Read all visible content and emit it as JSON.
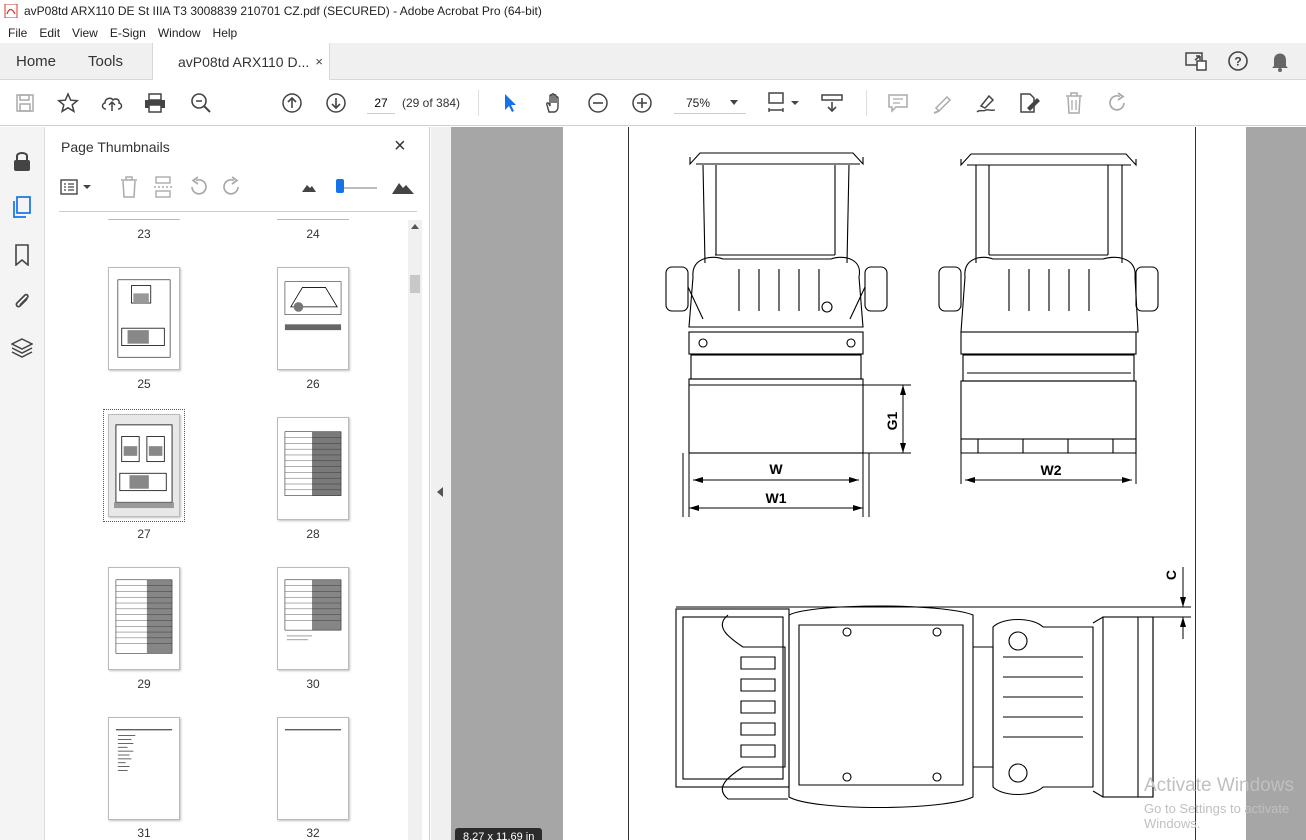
{
  "window": {
    "title": "avP08td ARX110 DE St IIIA T3 3008839 210701 CZ.pdf (SECURED) - Adobe Acrobat Pro (64-bit)"
  },
  "menu": [
    "File",
    "Edit",
    "View",
    "E-Sign",
    "Window",
    "Help"
  ],
  "tabs": {
    "home": "Home",
    "tools": "Tools",
    "document": "avP08td ARX110 D...",
    "close": "×"
  },
  "toolbar": {
    "page_number": "27",
    "page_count": "(29 of 384)",
    "zoom": "75%"
  },
  "thumbnails": {
    "title": "Page Thumbnails",
    "close": "×",
    "pages": [
      "23",
      "24",
      "25",
      "26",
      "27",
      "28",
      "29",
      "30",
      "31",
      "32"
    ],
    "selected": "27"
  },
  "document": {
    "dimension_labels": [
      "G1",
      "W",
      "W1",
      "W2",
      "C"
    ],
    "page_size": "8.27 x 11.69 in"
  },
  "watermark": {
    "line1": "Activate Windows",
    "line2": "Go to Settings to activate Windows."
  },
  "colors": {
    "accent": "#1473e6",
    "pdf_red": "#d7372d",
    "doc_background": "#a6a6a6"
  }
}
